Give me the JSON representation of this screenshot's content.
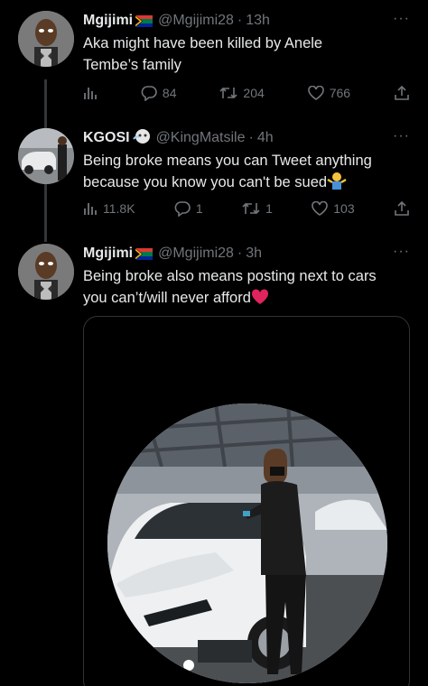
{
  "tweets": [
    {
      "name": "Mgijimi",
      "handle": "@Mgijimi28",
      "sep": "·",
      "time": "13h",
      "more": "···",
      "text": "Aka might have been killed by Anele Tembe’s family",
      "stats": {
        "views": "",
        "replies": "84",
        "retweets": "204",
        "likes": "766"
      }
    },
    {
      "name": "KGOSI",
      "handle": "@KingMatsile",
      "sep": "·",
      "time": "4h",
      "more": "···",
      "text": "Being broke means you can Tweet anything because you know you can't be sued",
      "stats": {
        "views": "11.8K",
        "replies": "1",
        "retweets": "1",
        "likes": "103"
      }
    },
    {
      "name": "Mgijimi",
      "handle": "@Mgijimi28",
      "sep": "·",
      "time": "3h",
      "more": "···",
      "text": "Being broke also means posting next to cars you can’t/will never afford"
    }
  ],
  "icons": {
    "flag": "south-africa-flag-icon",
    "badge": "face-emoji-icon",
    "shrug": "shrug-emoji-icon",
    "heart": "red-heart-emoji-icon",
    "views": "views-chart-icon",
    "reply": "reply-icon",
    "retweet": "retweet-icon",
    "like": "like-icon",
    "share": "share-icon"
  },
  "colors": {
    "background": "#000000",
    "text": "#e7e9ea",
    "muted": "#71767b",
    "thread_line": "#333639",
    "heart": "#e0245e"
  }
}
